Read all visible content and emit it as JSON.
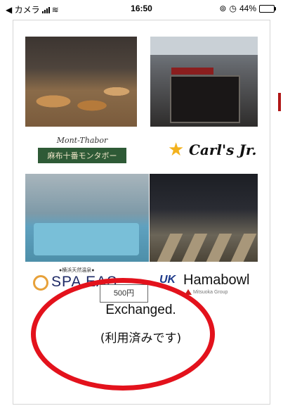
{
  "status_bar": {
    "back_app": "◀ カメラ",
    "time": "16:50",
    "battery_percent": "44%"
  },
  "coupon": {
    "logos": {
      "mont_script": "Mont-Thabor",
      "mont_jp": "麻布十番モンタボー",
      "carls": "Carl's Jr.",
      "spa_small": "●横浜天然温泉●",
      "spa": "SPA EAS",
      "hama_mark": "UK",
      "hama": "Hamabowl"
    },
    "value_label": "500円",
    "group_label": "Mitsuoka Group",
    "exchanged_label": "Exchanged.",
    "exchanged_jp_label": "(利用済みです)"
  },
  "colors": {
    "accent_red": "#e3121c",
    "mont_green": "#2e5a36",
    "carls_star": "#f3b21d",
    "spa_navy": "#1e2a66"
  }
}
